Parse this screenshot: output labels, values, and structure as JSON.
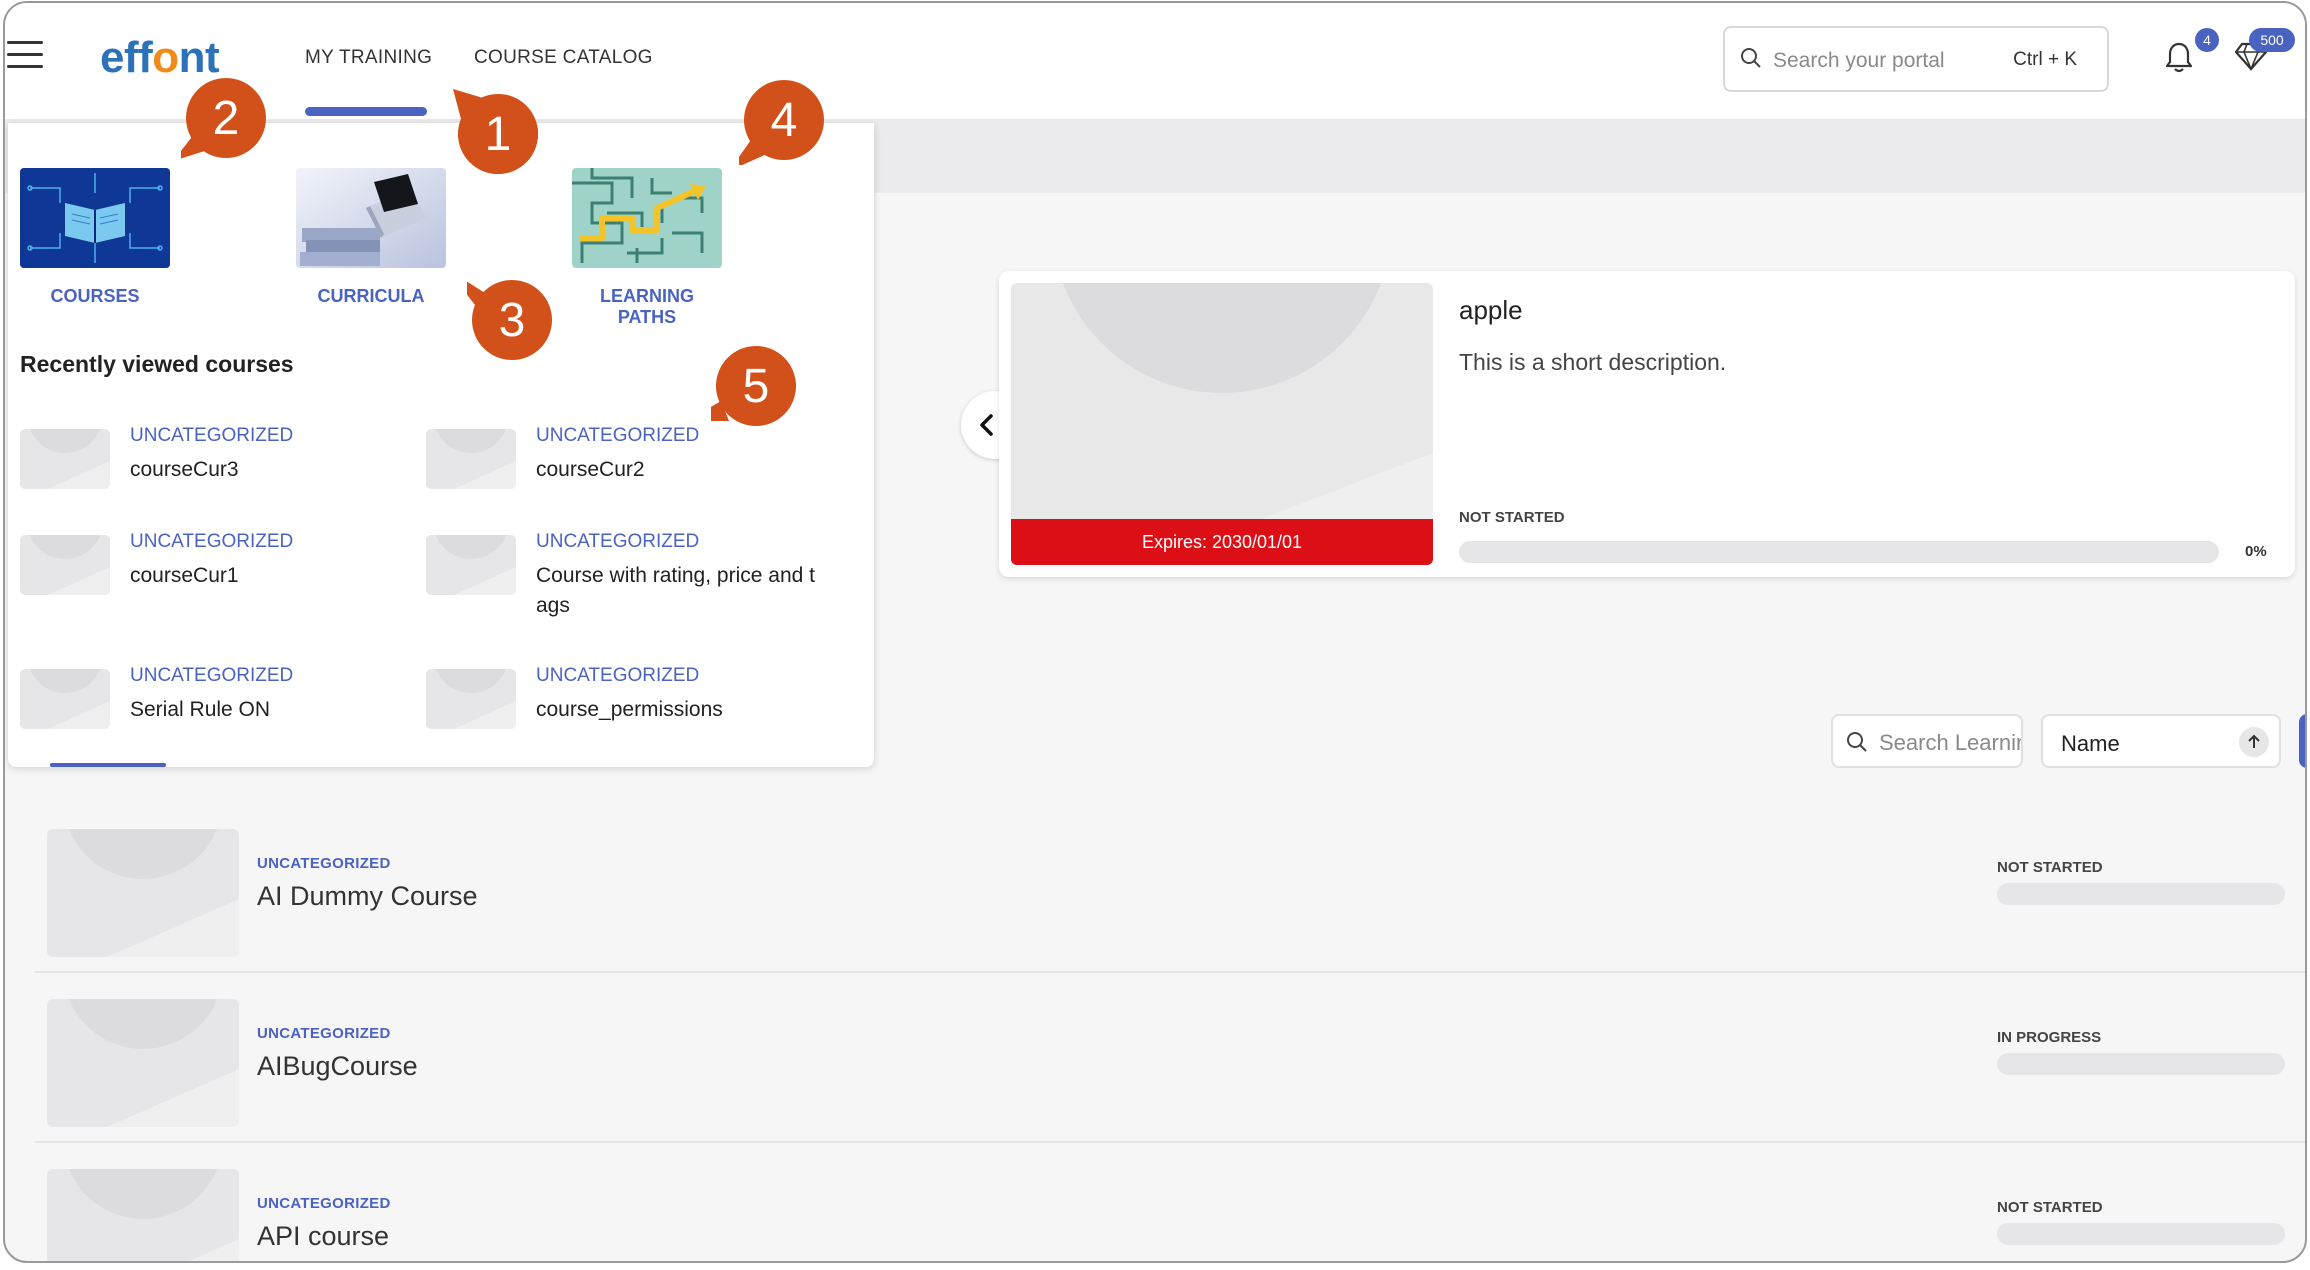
{
  "header": {
    "logo": {
      "left": "eff",
      "o": "o",
      "right": "nt"
    },
    "nav": {
      "my_training": "MY TRAINING",
      "course_catalog": "COURSE CATALOG"
    },
    "search": {
      "placeholder": "Search your portal",
      "shortcut": "Ctrl + K"
    },
    "notifications_count": "4",
    "points_count": "500"
  },
  "dropdown": {
    "categories": [
      {
        "label": "COURSES",
        "icon": "book-circuit-image"
      },
      {
        "label": "CURRICULA",
        "icon": "laptop-books-image"
      },
      {
        "label": "LEARNING PATHS",
        "icon": "maze-arrow-image"
      }
    ],
    "recent_heading": "Recently viewed courses",
    "recent": [
      {
        "category": "UNCATEGORIZED",
        "name": "courseCur3"
      },
      {
        "category": "UNCATEGORIZED",
        "name": "courseCur2"
      },
      {
        "category": "UNCATEGORIZED",
        "name": "courseCur1"
      },
      {
        "category": "UNCATEGORIZED",
        "name": "Course with rating, price and tags"
      },
      {
        "category": "UNCATEGORIZED",
        "name": "Serial Rule ON"
      },
      {
        "category": "UNCATEGORIZED",
        "name": "course_permissions"
      }
    ]
  },
  "callouts": [
    "1",
    "2",
    "3",
    "4",
    "5"
  ],
  "featured": {
    "title": "apple",
    "description": "This is a short description.",
    "expires": "Expires: 2030/01/01",
    "status": "NOT STARTED",
    "progress_pct": 0,
    "progress_label": "0%"
  },
  "filters": {
    "search_placeholder": "Search Learning",
    "sort_value": "Name",
    "sort_direction": "ascending"
  },
  "courses": [
    {
      "category": "UNCATEGORIZED",
      "name": "AI Dummy Course",
      "status": "NOT STARTED"
    },
    {
      "category": "UNCATEGORIZED",
      "name": "AIBugCourse",
      "status": "IN PROGRESS"
    },
    {
      "category": "UNCATEGORIZED",
      "name": "API course",
      "status": "NOT STARTED"
    }
  ],
  "colors": {
    "accent": "#4a63c0",
    "logo_blue": "#2d72b8",
    "logo_orange": "#f08a1c",
    "expires_red": "#dc0f17",
    "callout": "#d2501a"
  }
}
